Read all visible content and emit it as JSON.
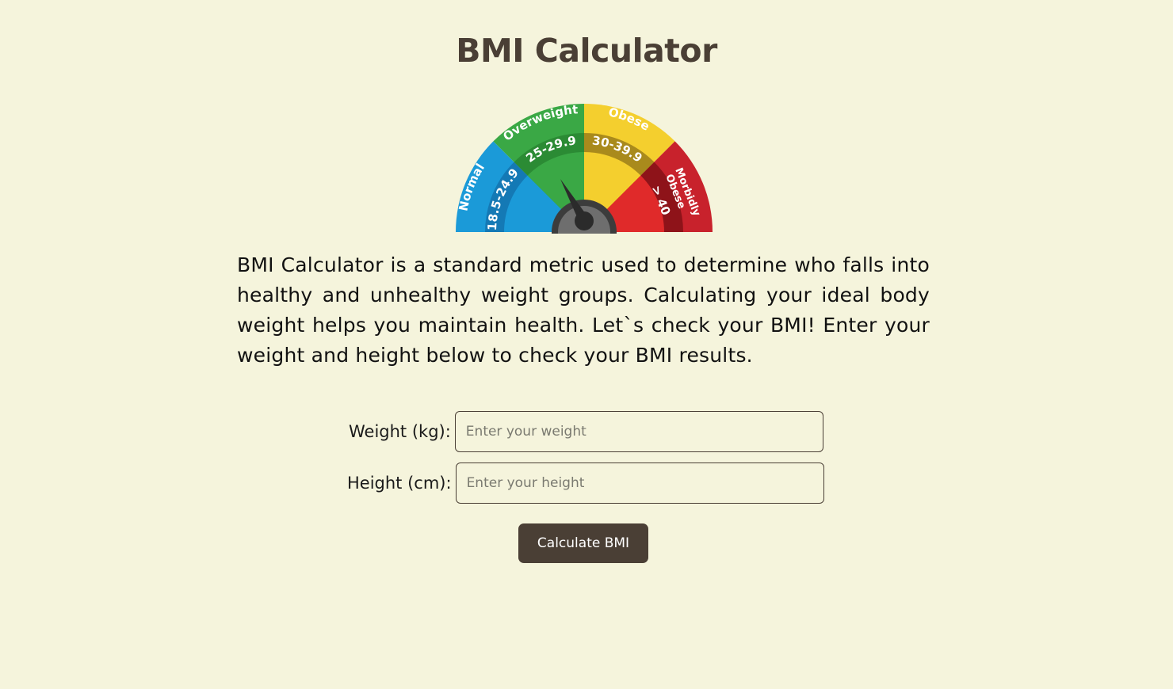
{
  "page": {
    "title": "BMI Calculator",
    "description": "BMI Calculator is a standard metric used to determine who falls into healthy and unhealthy weight groups. Calculating your ideal body weight helps you maintain health. Let`s check your BMI! Enter your weight and height below to check your BMI results."
  },
  "gauge": {
    "segments": [
      {
        "label": "Normal",
        "range": "18.5-24.9",
        "color": "#1b9ad8",
        "inner_color": "#1479b5"
      },
      {
        "label": "Overweight",
        "range": "25-29.9",
        "color": "#3aa845",
        "inner_color": "#2b8b34"
      },
      {
        "label": "Obese",
        "range": "30-39.9",
        "color": "#f4cf2e",
        "inner_color": "#a98a1c"
      },
      {
        "label": "Morbidly Obese",
        "label_line1": "Morbidly",
        "label_line2": "Obese",
        "range": "> 40",
        "color": "#c8222c",
        "inner_color": "#8e1319"
      }
    ]
  },
  "form": {
    "weight_label": "Weight (kg):",
    "weight_placeholder": "Enter your weight",
    "height_label": "Height (cm):",
    "height_placeholder": "Enter your height",
    "submit_label": "Calculate BMI"
  },
  "colors": {
    "background": "#f5f4dc",
    "accent": "#4a3f35"
  }
}
